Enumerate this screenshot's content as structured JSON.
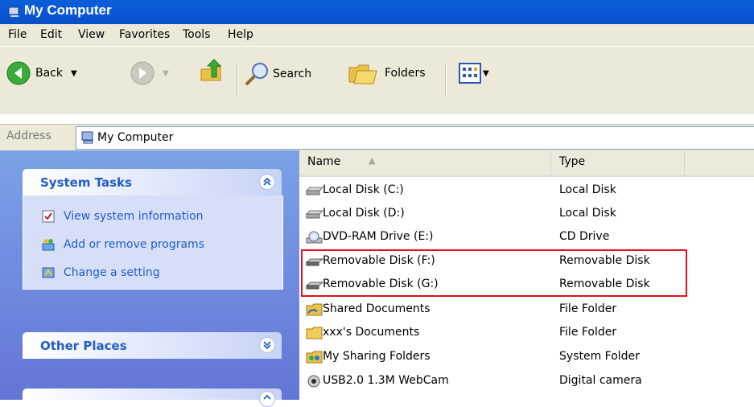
{
  "window": {
    "title": "My Computer"
  },
  "menu": [
    "File",
    "Edit",
    "View",
    "Favorites",
    "Tools",
    "Help"
  ],
  "toolbar": {
    "back": "Back",
    "search": "Search",
    "folders": "Folders"
  },
  "address": {
    "label": "Address",
    "value": "My Computer"
  },
  "system_tasks": {
    "title": "System Tasks",
    "items": [
      {
        "label": "View system information",
        "icon": "system-info-icon"
      },
      {
        "label": "Add or remove programs",
        "icon": "add-remove-programs-icon"
      },
      {
        "label": "Change a setting",
        "icon": "control-panel-icon"
      }
    ]
  },
  "other_places": {
    "title": "Other Places"
  },
  "columns": {
    "name": "Name",
    "type": "Type"
  },
  "files": [
    {
      "name": "Local Disk (C:)",
      "type": "Local Disk",
      "icon": "hard-drive-icon"
    },
    {
      "name": "Local Disk (D:)",
      "type": "Local Disk",
      "icon": "hard-drive-icon"
    },
    {
      "name": "DVD-RAM Drive (E:)",
      "type": "CD Drive",
      "icon": "dvd-drive-icon"
    },
    {
      "name": "Removable Disk (F:)",
      "type": "Removable Disk",
      "icon": "removable-disk-icon"
    },
    {
      "name": "Removable Disk (G:)",
      "type": "Removable Disk",
      "icon": "removable-disk-icon"
    },
    {
      "name": "Shared Documents",
      "type": "File Folder",
      "icon": "shared-folder-icon"
    },
    {
      "name": "xxx's Documents",
      "type": "File Folder",
      "icon": "folder-icon"
    },
    {
      "name": "My Sharing Folders",
      "type": "System Folder",
      "icon": "sharing-folder-icon"
    },
    {
      "name": "USB2.0 1.3M WebCam",
      "type": "Digital camera",
      "icon": "webcam-icon"
    }
  ],
  "colors": {
    "highlight": "#e3101e",
    "task_link": "#215dc6",
    "titlebar": "#0a5fd6"
  }
}
